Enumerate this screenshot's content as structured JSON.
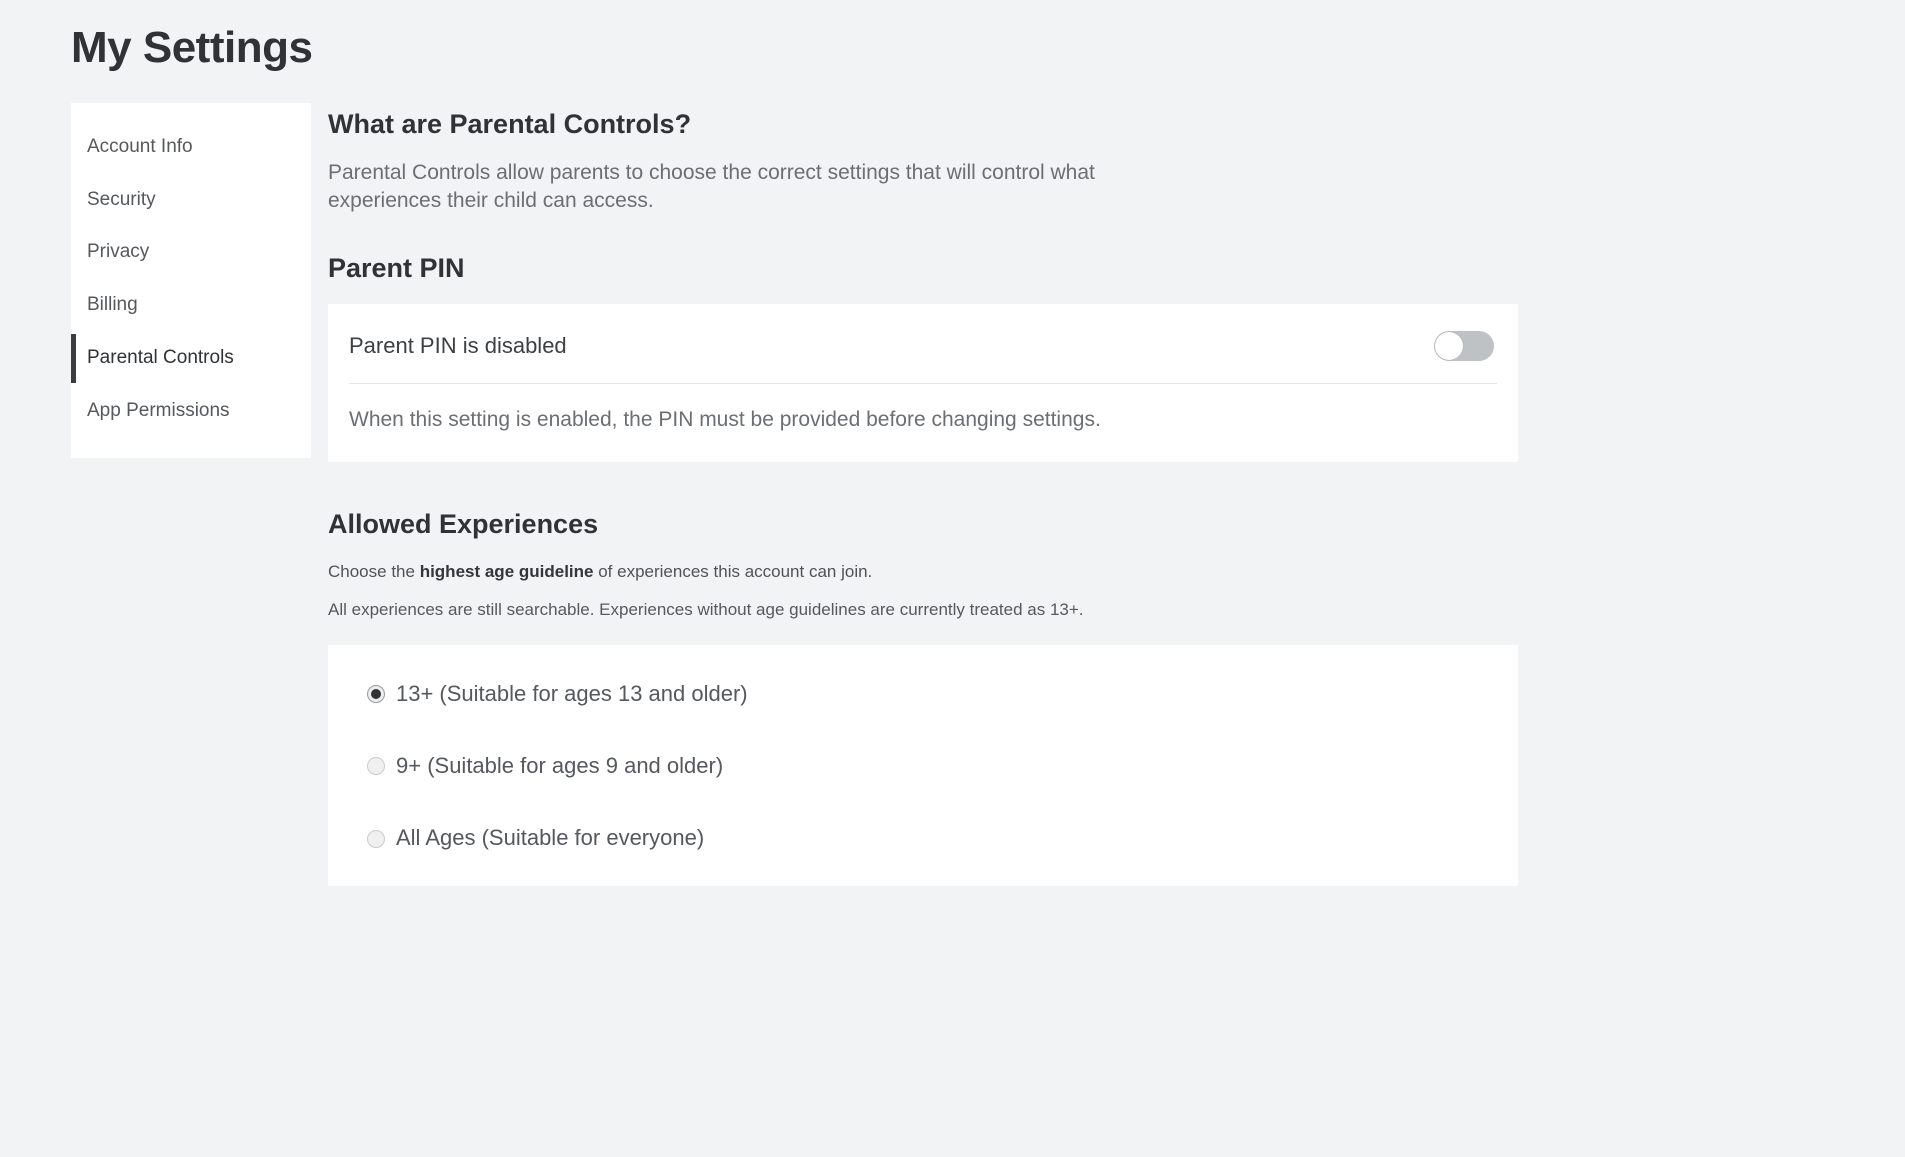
{
  "page": {
    "title": "My Settings"
  },
  "sidebar": {
    "items": [
      {
        "label": "Account Info",
        "active": false
      },
      {
        "label": "Security",
        "active": false
      },
      {
        "label": "Privacy",
        "active": false
      },
      {
        "label": "Billing",
        "active": false
      },
      {
        "label": "Parental Controls",
        "active": true
      },
      {
        "label": "App Permissions",
        "active": false
      }
    ]
  },
  "main": {
    "about": {
      "heading": "What are Parental Controls?",
      "body": "Parental Controls allow parents to choose the correct settings that will control what experiences their child can access."
    },
    "parent_pin": {
      "heading": "Parent PIN",
      "status_label": "Parent PIN is disabled",
      "toggle_state": "off",
      "help_text": "When this setting is enabled, the PIN must be provided before changing settings."
    },
    "allowed_experiences": {
      "heading": "Allowed Experiences",
      "helper_prefix": "Choose the ",
      "helper_bold": "highest age guideline",
      "helper_suffix": " of experiences this account can join.",
      "helper_secondary": "All experiences are still searchable. Experiences without age guidelines are currently treated as 13+.",
      "options": [
        {
          "label": "13+ (Suitable for ages 13 and older)",
          "selected": true
        },
        {
          "label": "9+ (Suitable for ages 9 and older)",
          "selected": false
        },
        {
          "label": "All Ages (Suitable for everyone)",
          "selected": false
        }
      ]
    }
  },
  "colors": {
    "background": "#f2f3f5",
    "card": "#ffffff",
    "active_indicator": "#3b3d40",
    "toggle_off_track": "#bfc2c5",
    "radio_selected_dot": "#303335"
  }
}
